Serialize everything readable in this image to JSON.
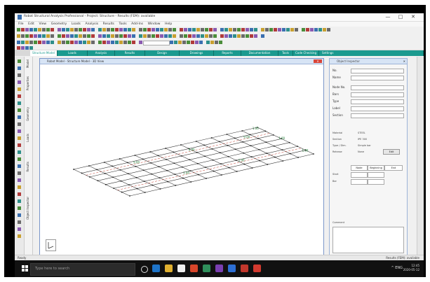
{
  "window": {
    "title": "Robot Structural Analysis Professional - Project: Structure - Results (FEM): available",
    "controls": [
      "—",
      "□",
      "✕"
    ]
  },
  "menu": [
    "File",
    "Edit",
    "View",
    "Geometry",
    "Loads",
    "Analysis",
    "Results",
    "Tools",
    "Add-Ins",
    "Window",
    "Help"
  ],
  "ribbon_tabs": [
    "Structure Model",
    "Loads",
    "Analysis",
    "Results",
    "Design",
    "Drawings",
    "Reports",
    "Documentation",
    "Tools",
    "Code Checking",
    "Settings"
  ],
  "side_tabs": [
    "Model",
    "Properties",
    "Geometry",
    "Loads",
    "Results",
    "Object Inspector"
  ],
  "model_window": {
    "title": "Robot Model - Structure Model - 3D View",
    "close": "✕",
    "dimension_labels": [
      "9.00",
      "9.00",
      "9.00",
      "1.00",
      "1.00",
      "1.00",
      "1.00",
      "1.00"
    ]
  },
  "right_panel": {
    "title": "Object Inspector",
    "close": "✕",
    "fields": [
      "No.",
      "Name",
      "Node No.",
      "Bars",
      "Type",
      "Label",
      "Section"
    ],
    "properties": [
      {
        "label": "Material",
        "value": "STEEL"
      },
      {
        "label": "Section",
        "value": "IPE 300"
      },
      {
        "label": "Type / Dim.",
        "value": "Simple bar"
      },
      {
        "label": "Release",
        "value": "None"
      }
    ],
    "edit_button": "Edit",
    "grid_headers": [
      "Node",
      "Beginning",
      "End"
    ],
    "grid_rows": [
      [
        "Start",
        "",
        ""
      ],
      [
        "Bar",
        "",
        ""
      ]
    ],
    "comment_label": "Comment"
  },
  "status": {
    "left": "Ready",
    "right": "Results (FEM): available"
  },
  "taskbar": {
    "search_placeholder": "Type here to search",
    "tray": "^  ENG",
    "time": "12:45",
    "date": "2020-05-12"
  },
  "colors": {
    "ribbon_accent": "#1b9a8f",
    "window_border": "#7a95c9",
    "taskbar": "#111111"
  }
}
